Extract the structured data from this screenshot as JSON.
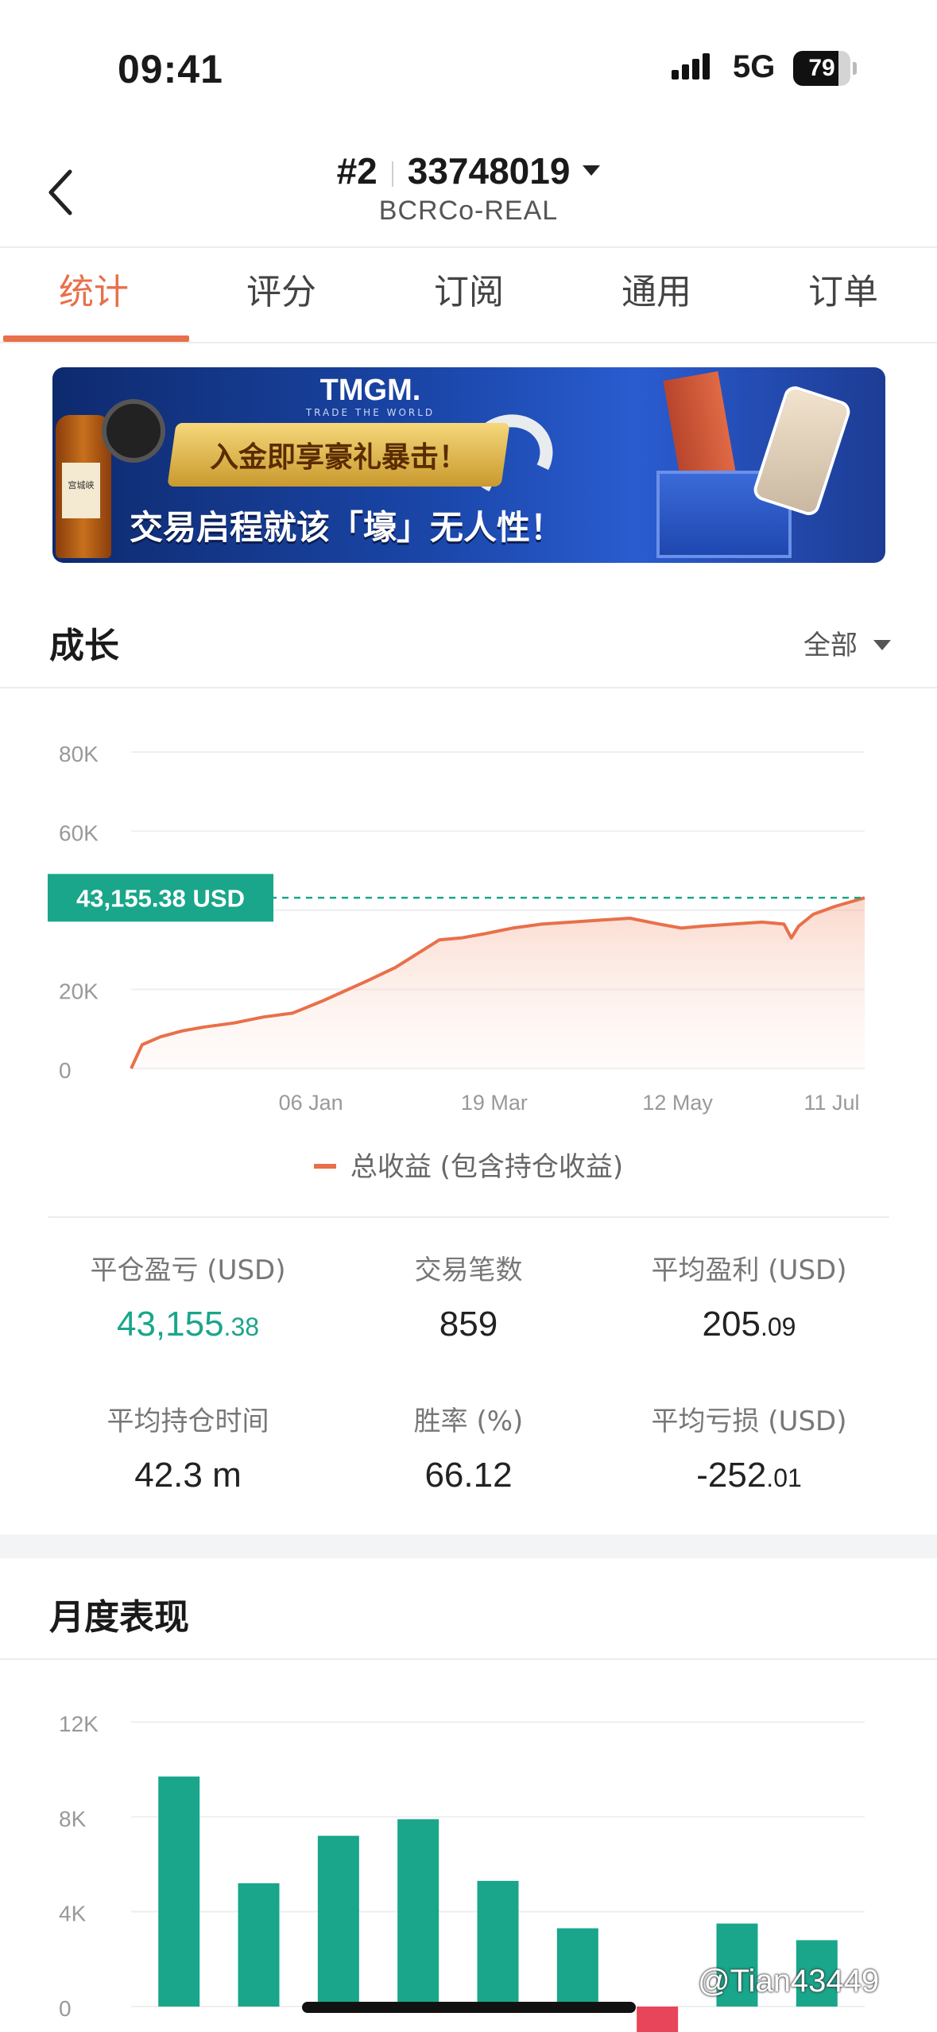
{
  "status_bar": {
    "time": "09:41",
    "network": "5G",
    "battery_level": "79",
    "battery_fraction": 0.79
  },
  "header": {
    "account_rank": "#2",
    "account_number": "33748019",
    "server": "BCRCo-REAL"
  },
  "tabs": [
    {
      "label": "统计",
      "active": true
    },
    {
      "label": "评分",
      "active": false
    },
    {
      "label": "订阅",
      "active": false
    },
    {
      "label": "通用",
      "active": false
    },
    {
      "label": "订单",
      "active": false
    }
  ],
  "banner": {
    "brand": "TMGM.",
    "tagline": "TRADE THE WORLD",
    "line1": "入金即享豪礼暴击！",
    "line2": "交易启程就该「壕」无人性！",
    "bottle_label": "宫城峡"
  },
  "growth": {
    "title": "成长",
    "range_label": "全部",
    "current_value_label": "43,155.38 USD",
    "legend": "总收益 (包含持仓收益)"
  },
  "stats": {
    "closed_pnl": {
      "label": "平仓盈亏 (USD)",
      "int": "43,155",
      "dec": ".38"
    },
    "trade_count": {
      "label": "交易笔数",
      "value": "859"
    },
    "avg_profit": {
      "label": "平均盈利 (USD)",
      "int": "205",
      "dec": ".09"
    },
    "avg_hold_time": {
      "label": "平均持仓时间",
      "value": "42.3 m"
    },
    "win_rate": {
      "label": "胜率 (%)",
      "value": "66.12"
    },
    "avg_loss": {
      "label": "平均亏损 (USD)",
      "int": "-252",
      "dec": ".01"
    }
  },
  "monthly": {
    "title": "月度表现"
  },
  "watermark": "@Tian43449",
  "colors": {
    "accent": "#e8704a",
    "green": "#19a68b",
    "red": "#e8455a",
    "grid": "#efefef"
  },
  "chart_data": [
    {
      "type": "area",
      "ylim": [
        0,
        80000
      ],
      "yticks": [
        0,
        20000,
        40000,
        60000,
        80000
      ],
      "ytick_labels": [
        "0",
        "20K",
        "",
        "60K",
        "80K"
      ],
      "xlim": [
        0,
        1
      ],
      "xticks": [
        {
          "label": "06 Jan",
          "pos": 0.245
        },
        {
          "label": "19 Mar",
          "pos": 0.495
        },
        {
          "label": "12 May",
          "pos": 0.745
        },
        {
          "label": "11 Jul",
          "pos": 0.955
        }
      ],
      "series": [
        {
          "name": "总收益 (包含持仓收益)",
          "points": [
            [
              0.0,
              0
            ],
            [
              0.015,
              6000
            ],
            [
              0.04,
              8000
            ],
            [
              0.07,
              9500
            ],
            [
              0.1,
              10500
            ],
            [
              0.14,
              11500
            ],
            [
              0.18,
              13000
            ],
            [
              0.22,
              14000
            ],
            [
              0.26,
              17000
            ],
            [
              0.29,
              19500
            ],
            [
              0.32,
              22000
            ],
            [
              0.36,
              25500
            ],
            [
              0.39,
              29000
            ],
            [
              0.42,
              32500
            ],
            [
              0.45,
              33000
            ],
            [
              0.48,
              34000
            ],
            [
              0.52,
              35500
            ],
            [
              0.56,
              36500
            ],
            [
              0.6,
              37000
            ],
            [
              0.64,
              37500
            ],
            [
              0.68,
              38000
            ],
            [
              0.72,
              36500
            ],
            [
              0.75,
              35500
            ],
            [
              0.78,
              36000
            ],
            [
              0.82,
              36500
            ],
            [
              0.86,
              37000
            ],
            [
              0.89,
              36500
            ],
            [
              0.9,
              33000
            ],
            [
              0.91,
              36000
            ],
            [
              0.93,
              39000
            ],
            [
              0.96,
              41000
            ],
            [
              1.0,
              43155.38
            ]
          ]
        }
      ],
      "current_value": 43155.38
    },
    {
      "type": "bar",
      "ylim": [
        0,
        12000
      ],
      "yticks": [
        0,
        4000,
        8000,
        12000
      ],
      "ytick_labels": [
        "0",
        "4K",
        "8K",
        "12K"
      ],
      "values": [
        9700,
        5200,
        7200,
        7900,
        5300,
        3300,
        -1200,
        3500,
        2800
      ]
    }
  ]
}
